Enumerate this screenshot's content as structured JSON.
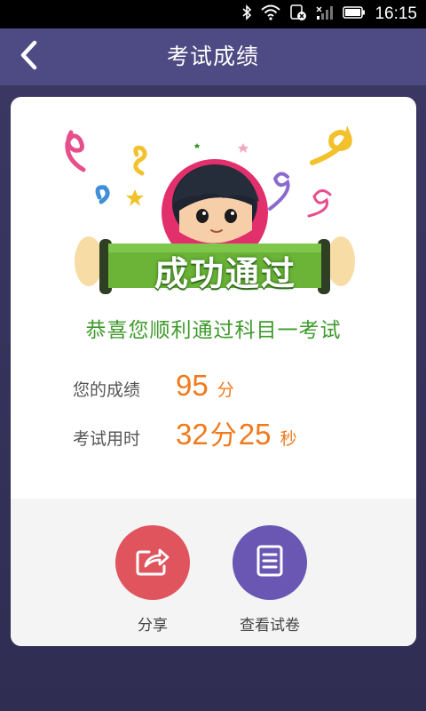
{
  "status_bar": {
    "time": "16:15",
    "icons": [
      "bluetooth-icon",
      "wifi-icon",
      "sim-off-icon",
      "signal-icon",
      "battery-icon"
    ]
  },
  "header": {
    "title": "考试成绩",
    "back_icon": "chevron-left-icon"
  },
  "result": {
    "banner_text": "成功通过",
    "congrats": "恭喜您顺利通过科目一考试",
    "score_label": "您的成绩",
    "score_value": "95",
    "score_unit": "分",
    "time_label": "考试用时",
    "time_minutes": "32",
    "time_minutes_unit": "分",
    "time_seconds": "25",
    "time_seconds_unit": "秒"
  },
  "actions": [
    {
      "label": "分享",
      "icon": "share-icon",
      "color": "#e0555d"
    },
    {
      "label": "查看试卷",
      "icon": "document-icon",
      "color": "#6a57b4"
    }
  ],
  "colors": {
    "header": "#4e4a84",
    "background": "#2f2d52",
    "accent_green": "#3f9a2c",
    "accent_orange": "#f07a1c"
  }
}
